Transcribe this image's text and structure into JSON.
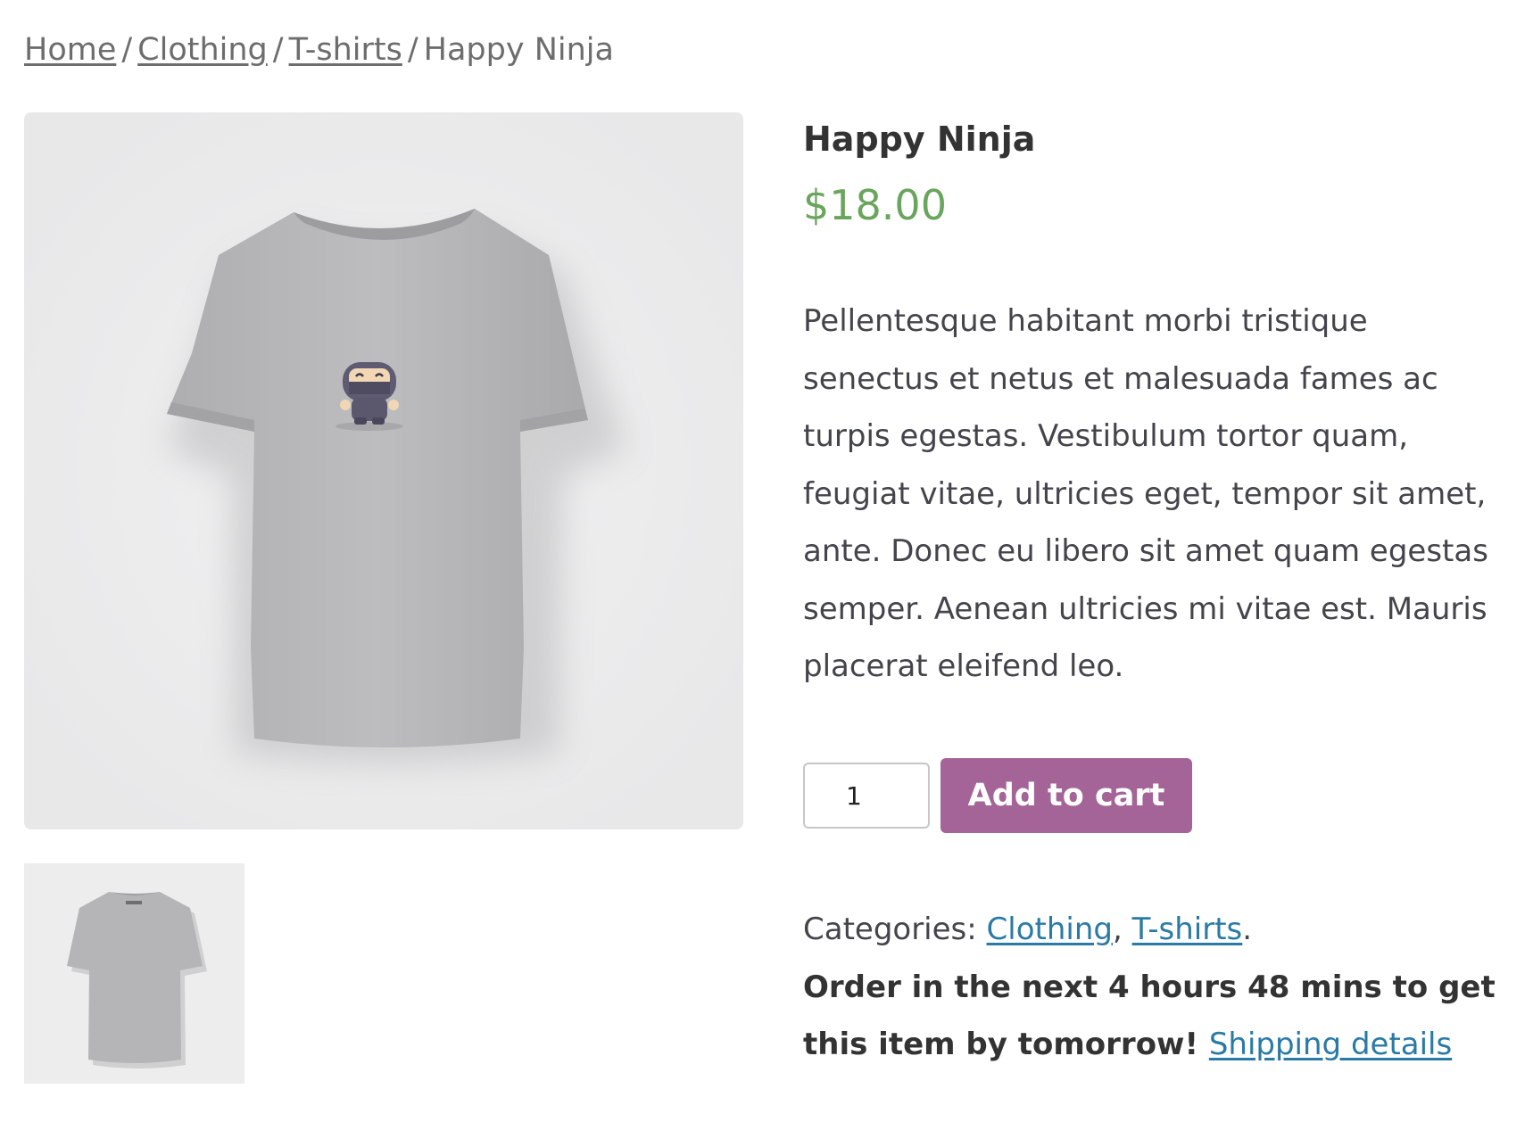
{
  "breadcrumb": {
    "items": [
      "Home",
      "Clothing",
      "T-shirts"
    ],
    "separator": "/",
    "current": "Happy Ninja"
  },
  "product": {
    "title": "Happy Ninja",
    "price": "$18.00",
    "description": "Pellentesque habitant morbi tristique senectus et netus et malesuada fames ac turpis egestas. Vestibulum tortor quam, feugiat vitae, ultricies eget, tempor sit amet, ante. Donec eu libero sit amet quam egestas semper. Aenean ultricies mi vitae est. Mauris placerat eleifend leo.",
    "quantity": "1",
    "add_to_cart_label": "Add to cart",
    "main_image_icon": "tshirt-front-ninja-icon",
    "thumbnail_icon": "tshirt-back-icon"
  },
  "meta": {
    "categories_label": "Categories:",
    "categories": [
      "Clothing",
      "T-shirts"
    ],
    "category_separator": ",",
    "end_punct": ".",
    "shipping_text": "Order in the next 4 hours 48 mins to get this item by tomorrow!",
    "shipping_link": "Shipping details"
  },
  "colors": {
    "price": "#6aa55d",
    "button": "#a46497",
    "link": "#2a7aa6",
    "image_bg": "#ededee",
    "shirt": "#b7b7b9"
  }
}
